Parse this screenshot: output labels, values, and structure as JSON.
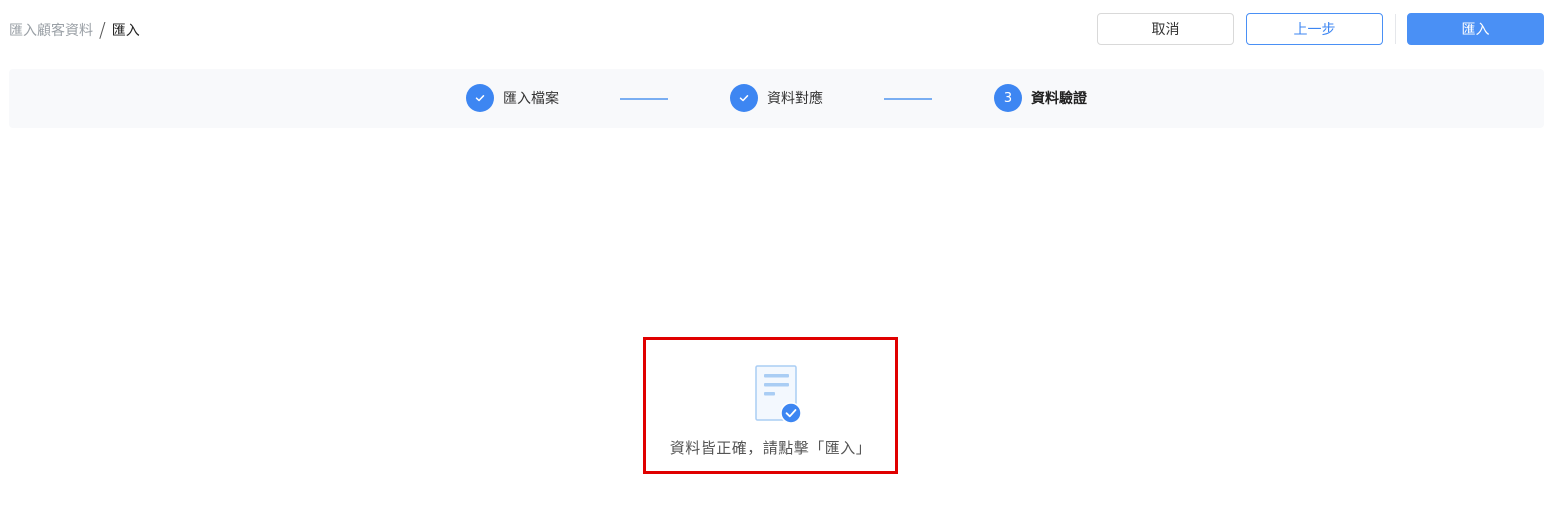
{
  "breadcrumb": {
    "parent": "匯入顧客資料",
    "separator": "/",
    "current": "匯入"
  },
  "actions": {
    "cancel_label": "取消",
    "prev_label": "上一步",
    "import_label": "匯入"
  },
  "steps": [
    {
      "label": "匯入檔案",
      "status": "done",
      "icon": "check-icon"
    },
    {
      "label": "資料對應",
      "status": "done",
      "icon": "check-icon"
    },
    {
      "label": "資料驗證",
      "status": "active",
      "number": "3"
    }
  ],
  "result": {
    "icon": "document-check-icon",
    "message": "資料皆正確，請點擊「匯入」"
  },
  "colors": {
    "primary": "#3d86f2",
    "highlight_border": "#e00000"
  }
}
